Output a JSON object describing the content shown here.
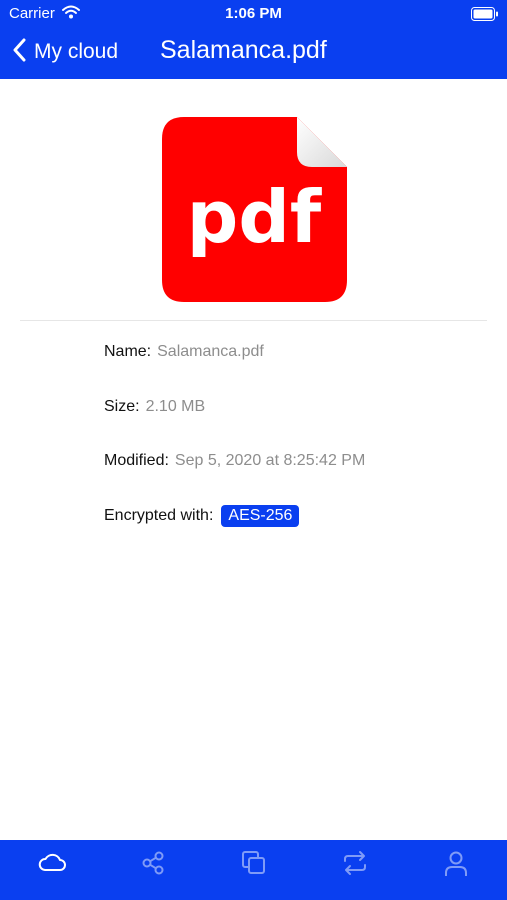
{
  "status_bar": {
    "carrier": "Carrier",
    "time": "1:06 PM"
  },
  "nav": {
    "back_label": "My cloud",
    "title": "Salamanca.pdf"
  },
  "file_icon": {
    "label": "pdf",
    "color": "#ff0000"
  },
  "details": {
    "name_label": "Name:",
    "name_value": "Salamanca.pdf",
    "size_label": "Size:",
    "size_value": "2.10 MB",
    "modified_label": "Modified:",
    "modified_value": "Sep 5, 2020 at 8:25:42 PM",
    "encrypted_label": "Encrypted with:",
    "encrypted_value": "AES-256"
  },
  "tabs": [
    {
      "icon": "cloud-icon",
      "active": true
    },
    {
      "icon": "share-icon",
      "active": false
    },
    {
      "icon": "copy-icon",
      "active": false
    },
    {
      "icon": "sync-icon",
      "active": false
    },
    {
      "icon": "user-icon",
      "active": false
    }
  ],
  "colors": {
    "accent": "#0a3ff0",
    "muted": "#8d8d8d"
  }
}
